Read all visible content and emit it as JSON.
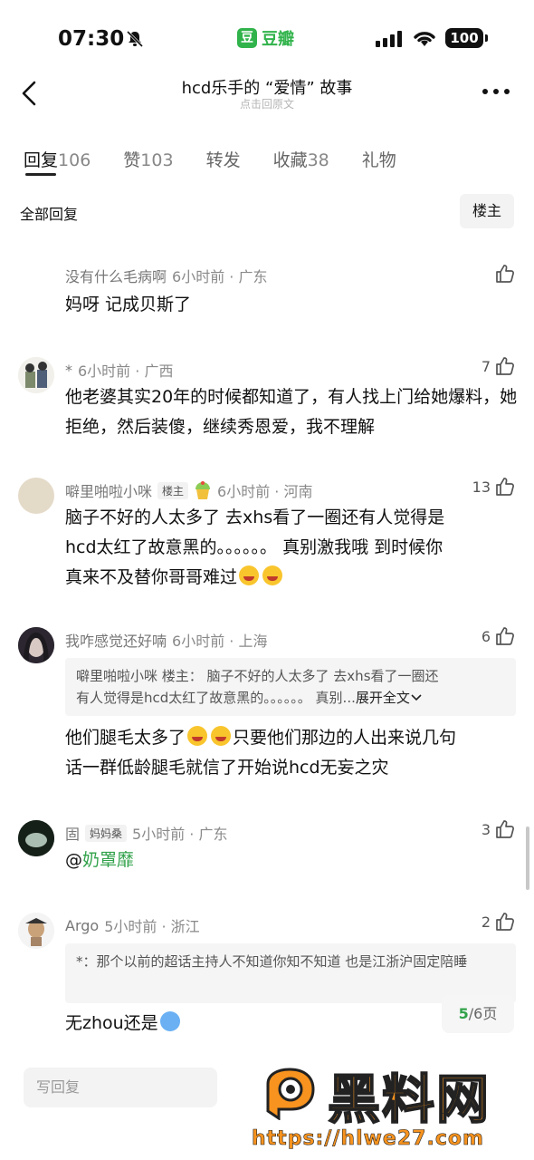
{
  "status_bar": {
    "time": "07:30",
    "app_icon_char": "豆",
    "app_name": "豆瓣",
    "battery": "100"
  },
  "nav": {
    "title": "hcd乐手的 “爱情” 故事",
    "subtitle": "点击回原文"
  },
  "tabs": [
    {
      "label": "回复",
      "count": "106"
    },
    {
      "label": "赞",
      "count": "103"
    },
    {
      "label": "转发",
      "count": ""
    },
    {
      "label": "收藏",
      "count": "38"
    },
    {
      "label": "礼物",
      "count": ""
    }
  ],
  "filter": {
    "label": "全部回复",
    "owner_button": "楼主"
  },
  "comments": [
    {
      "user": "没有什么毛病啊",
      "time": "6小时前 · 广东",
      "text": "妈呀 记成贝斯了",
      "likes": ""
    },
    {
      "user": "*",
      "time": "6小时前 · 广西",
      "text": "他老婆其实20年的时候都知道了，有人找上门给她爆料，她拒绝，然后装傻，继续秀恩爱，我不理解",
      "likes": "7"
    },
    {
      "user": "噼里啪啦小咪",
      "tag": "楼主",
      "time": "6小时前 · 河南",
      "text_lines": [
        "脑子不好的人太多了 去xhs看了一圈还有人觉得是",
        "hcd太红了故意黑的。。。。。。 真别激我哦 到时候你",
        "真来不及替你哥哥难过"
      ],
      "likes": "13"
    },
    {
      "user": "我咋感觉还好喃",
      "time": "6小时前 · 上海",
      "quote_line1": "噼里啪啦小咪 楼主： 脑子不好的人太多了 去xhs看了一圈还",
      "quote_line2": "有人觉得是hcd太红了故意黑的。。。。。。 真别...",
      "expand": "展开全文",
      "text_line1_a": "他们腿毛太多了",
      "text_line1_b": "只要他们那边的人出来说几句",
      "text_line2": "话一群低龄腿毛就信了开始说hcd无妄之灾",
      "likes": "6"
    },
    {
      "user": "固",
      "tag": "妈妈桑",
      "time": "5小时前 · 广东",
      "text_prefix": "@",
      "mention": "奶罩靡",
      "likes": "3"
    },
    {
      "user": "Argo",
      "time": "5小时前 · 浙江",
      "quote": "*：那个以前的超话主持人不知道你知不知道 也是江浙沪固定陪睡",
      "text": "无zhou还是",
      "likes": "2"
    }
  ],
  "pagination": {
    "current": "5",
    "total": "/6页"
  },
  "reply_placeholder": "写回复",
  "watermark": {
    "title": "黑料网",
    "url": "https://hlwe27.com"
  },
  "colors": {
    "accent_green": "#31b34b",
    "watermark_orange": "#f7931e"
  }
}
